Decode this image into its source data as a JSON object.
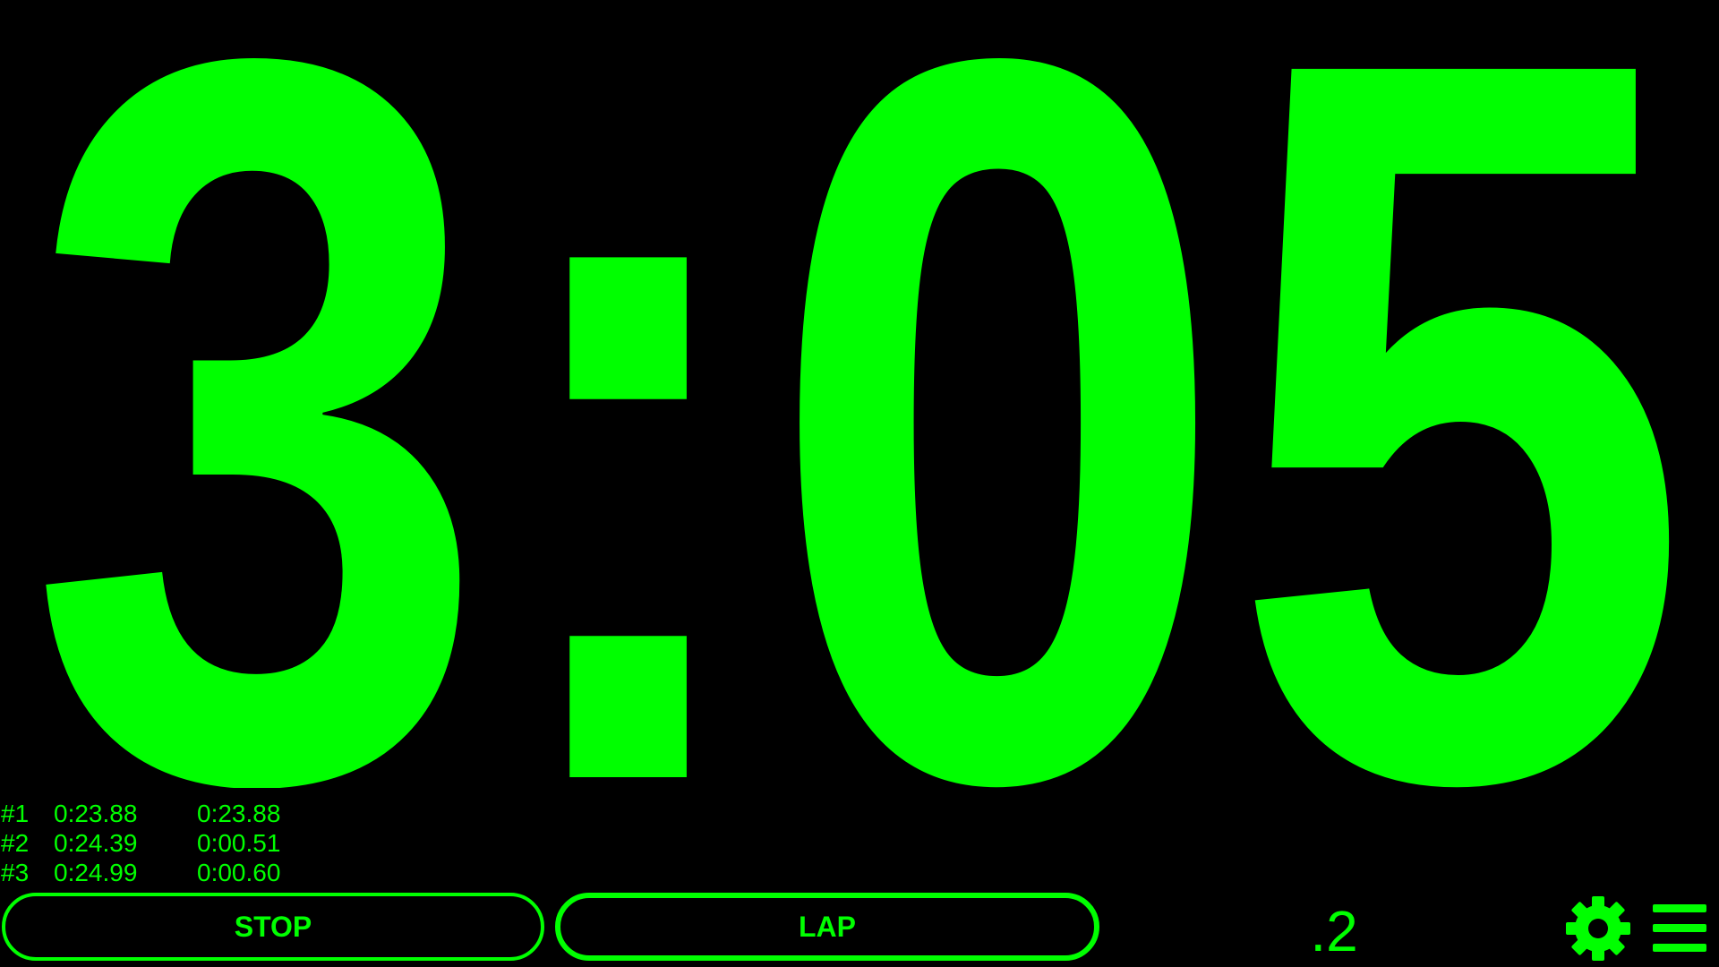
{
  "stopwatch": {
    "time_display": "3:05",
    "fraction": ".2",
    "color": "#00ff00",
    "background": "#000000"
  },
  "laps": [
    {
      "num": "#1",
      "total": "0:23.88",
      "split": "0:23.88"
    },
    {
      "num": "#2",
      "total": "0:24.39",
      "split": "0:00.51"
    },
    {
      "num": "#3",
      "total": "0:24.99",
      "split": "0:00.60"
    }
  ],
  "controls": {
    "stop_label": "STOP",
    "lap_label": "LAP"
  },
  "icons": {
    "settings": "gear-icon",
    "menu": "hamburger-menu-icon"
  }
}
